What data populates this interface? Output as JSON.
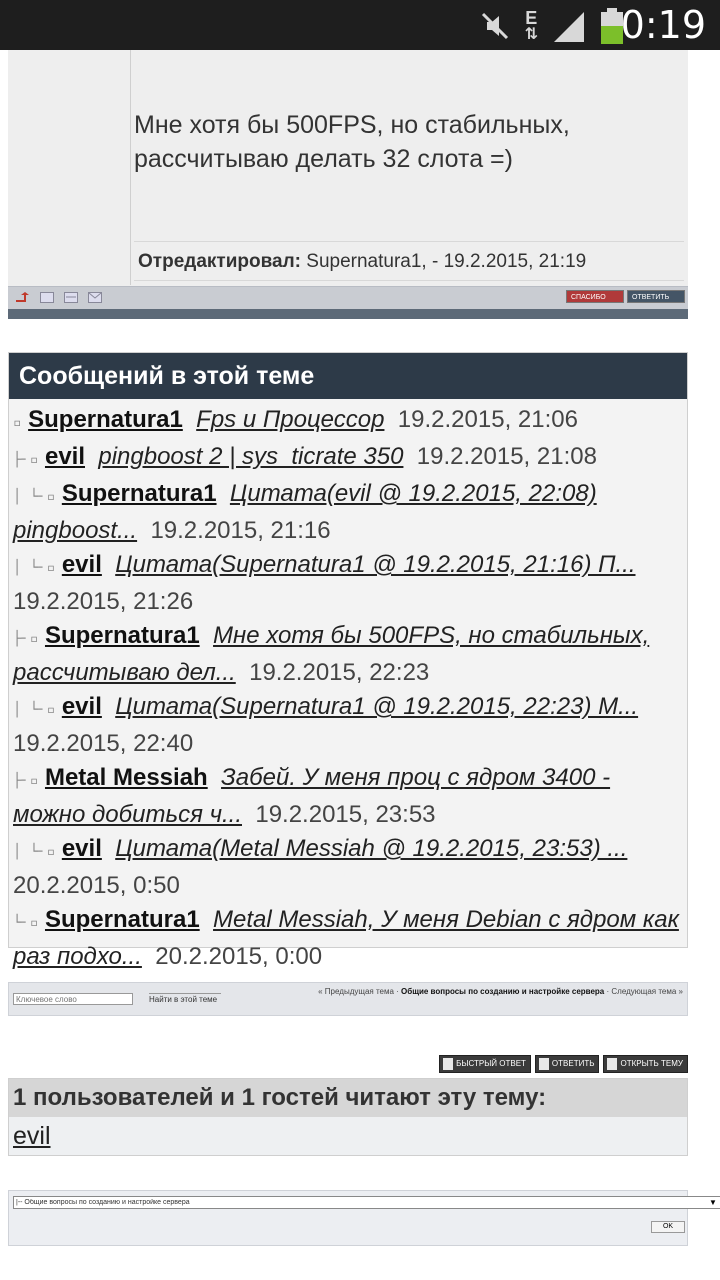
{
  "status_bar": {
    "time": "0:19",
    "network": "E",
    "icons": [
      "muted-icon",
      "data-arrows-icon",
      "signal-icon",
      "battery-icon"
    ]
  },
  "post": {
    "message_line1": "Мне хотя бы 500FPS, но стабильных,",
    "message_line2": "рассчитываю делать 32 слота =)",
    "edited_label": "Отредактировал:",
    "edited_value": "Supernatura1, - 19.2.2015, 21:19",
    "toolbar_buttons": [
      "спасибо",
      "ответить"
    ]
  },
  "thread": {
    "heading": "Сообщений в этой теме",
    "entries": [
      {
        "tree": "▫",
        "author": "Supernatura1",
        "title": "Fps и Процессор",
        "date": "19.2.2015, 21:06"
      },
      {
        "tree": "├╴▫",
        "author": "evil",
        "title": "pingboost 2 | sys_ticrate 350",
        "date": "19.2.2015, 21:08"
      },
      {
        "tree": "│ └╴▫",
        "author": "Supernatura1",
        "title": "Цитата(evil @ 19.2.2015, 22:08) pingboost...",
        "date": "19.2.2015, 21:16"
      },
      {
        "tree": "│   └╴▫",
        "author": "evil",
        "title": "Цитата(Supernatura1 @ 19.2.2015, 21:16) П...",
        "date": "19.2.2015, 21:26"
      },
      {
        "tree": "├╴▫",
        "author": "Supernatura1",
        "title": "Мне хотя бы 500FPS, но стабильных, рассчитываю дел...",
        "date": "19.2.2015, 22:23"
      },
      {
        "tree": "│ └╴▫",
        "author": "evil",
        "title": "Цитата(Supernatura1 @ 19.2.2015, 22:23) М...",
        "date": "19.2.2015, 22:40"
      },
      {
        "tree": "├╴▫",
        "author": "Metal Messiah",
        "title": "Забей. У меня проц с ядром 3400 - можно добиться ч...",
        "date": "19.2.2015, 23:53"
      },
      {
        "tree": "│ └╴▫",
        "author": "evil",
        "title": "Цитата(Metal Messiah @ 19.2.2015, 23:53) ...",
        "date": "20.2.2015, 0:50"
      },
      {
        "tree": "└╴▫",
        "author": "Supernatura1",
        "title": "Metal Messiah, У меня Debian с ядром как раз подхо...",
        "date": "20.2.2015, 0:00"
      }
    ]
  },
  "search": {
    "placeholder": "Ключевое слово",
    "button": "Найти в этой теме",
    "prev": "« Предыдущая тема",
    "sep1": " · ",
    "forum": "Общие вопросы по созданию и настройке сервера",
    "sep2": " · ",
    "next": "Следующая тема »"
  },
  "actions": {
    "fast_reply": "Быстрый ответ",
    "reply": "Ответить",
    "new_topic": "Открыть тему"
  },
  "readers": {
    "heading": "1 пользователей и 1 гостей читают эту тему:",
    "user": "evil"
  },
  "jump": {
    "selected": "|-- Общие вопросы по созданию и настройке сервера",
    "ok": "OK"
  }
}
